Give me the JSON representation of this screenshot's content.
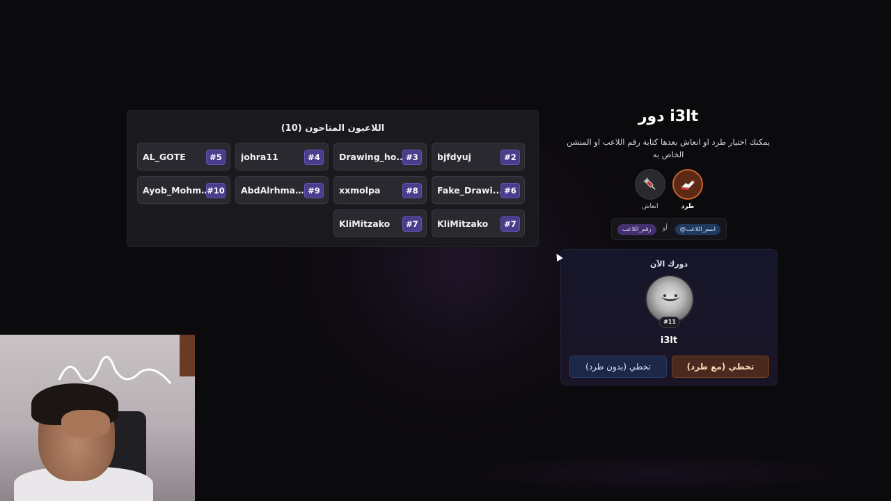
{
  "players_panel": {
    "title": "اللاعبون المتاحون (10)",
    "players": [
      {
        "name": "AL_GOTE",
        "number": "#5"
      },
      {
        "name": "johra11",
        "number": "#4"
      },
      {
        "name": "Drawing_ho...",
        "number": "#3"
      },
      {
        "name": "bjfdyuj",
        "number": "#2"
      },
      {
        "name": "Ayob_Mohma...",
        "number": "#10"
      },
      {
        "name": "AbdAlrhman...",
        "number": "#9"
      },
      {
        "name": "xxmolpa",
        "number": "#8"
      },
      {
        "name": "Fake_Drawi...",
        "number": "#6"
      },
      {
        "name": "KliMitzako",
        "number": "#7"
      },
      {
        "name": "KliMitzako",
        "number": "#7"
      }
    ]
  },
  "turn": {
    "title": "دور i3lt",
    "description": "يمكنك اختيار طرد او انعاش بعدها كتابة رقم اللاعب او المنشن الخاص به",
    "actions": {
      "kick_label": "طرد",
      "revive_label": "انعاش"
    },
    "mention_hint": {
      "mention_pill": "@اسم_اللاعب",
      "or_label": "أو",
      "number_pill": "رقم_اللاعب"
    }
  },
  "current_turn": {
    "title": "دورك الآن",
    "badge": "#11",
    "player_name": "i3lt",
    "skip_button": "تخطي (بدون طرد)",
    "skip_kick_button": "تخطي (مع طرد)"
  },
  "colors": {
    "accent_purple": "#4a3d8c",
    "kick_orange": "#c9622a",
    "skip_blue": "#1c2848"
  }
}
